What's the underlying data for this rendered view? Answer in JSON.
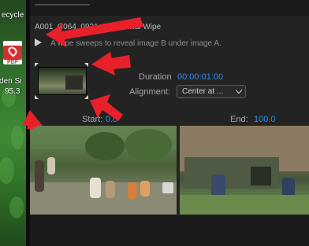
{
  "desktop": {
    "labels": [
      "ecycle",
      "den Si",
      "95.3"
    ],
    "pdf_icon_text": "PDF"
  },
  "effect": {
    "clip_name": "A001_C064_0921_01 - Radial Wipe",
    "description": "A wipe sweeps to reveal image B under image A.",
    "duration_label": "Duration",
    "duration_value": "00:00:01:00",
    "alignment_label": "Alignment:",
    "alignment_value": "Center at ...",
    "start_label": "Start:",
    "start_value": "0.0",
    "end_label": "End:",
    "end_value": "100.0"
  },
  "colors": {
    "accent": "#2d8ceb",
    "annotation_arrow": "#e8202a",
    "panel_bg": "#232323"
  },
  "icons": {
    "play": "play-icon",
    "dropdown": "chevron-down-icon",
    "corner_arrow": "corner-selector-icon"
  }
}
